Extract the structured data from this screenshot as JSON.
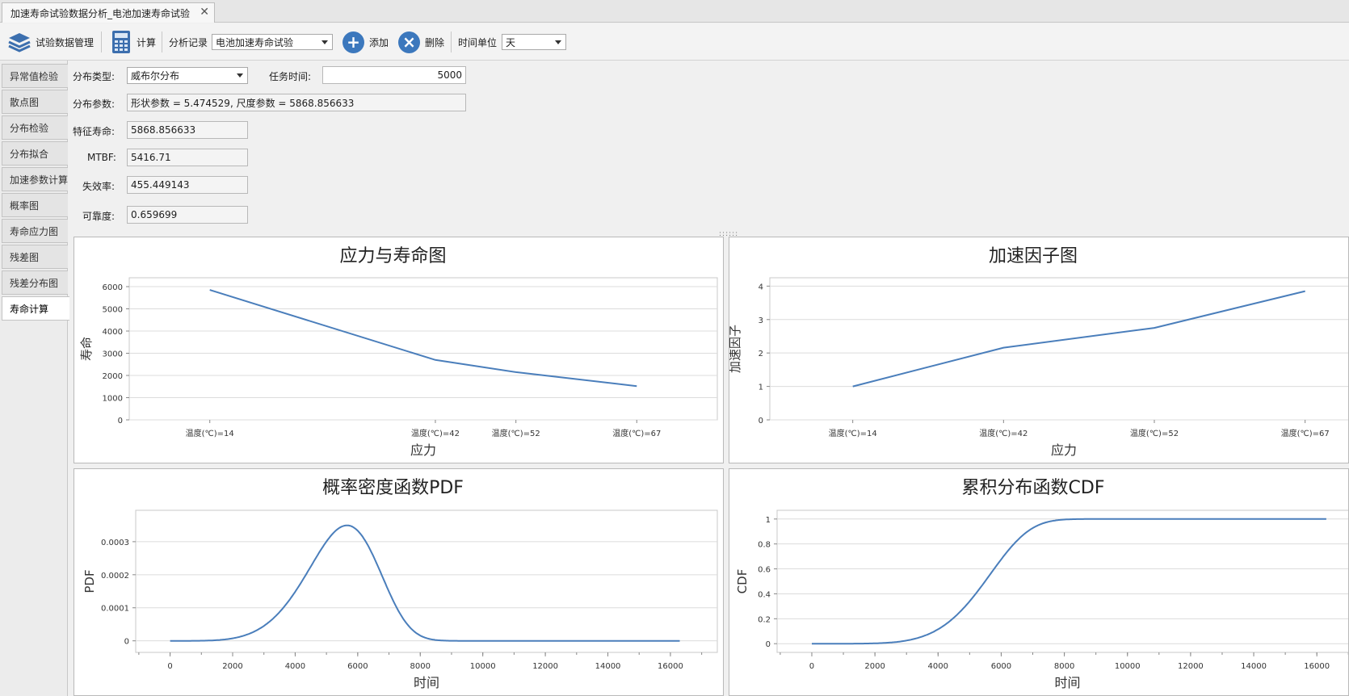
{
  "window": {
    "tab_title": "加速寿命试验数据分析_电池加速寿命试验",
    "tab_close": "✕"
  },
  "toolbar": {
    "data_manage_label": "试验数据管理",
    "calc_label": "计算",
    "record_label": "分析记录",
    "record_value": "电池加速寿命试验",
    "add_label": "添加",
    "add_glyph": "+",
    "delete_label": "删除",
    "delete_glyph": "×",
    "time_unit_label": "时间单位",
    "time_unit_value": "天"
  },
  "sidebar": {
    "items": [
      {
        "label": "异常值检验"
      },
      {
        "label": "散点图"
      },
      {
        "label": "分布检验"
      },
      {
        "label": "分布拟合"
      },
      {
        "label": "加速参数计算"
      },
      {
        "label": "概率图"
      },
      {
        "label": "寿命应力图"
      },
      {
        "label": "残差图"
      },
      {
        "label": "残差分布图"
      },
      {
        "label": "寿命计算"
      }
    ],
    "active_index": 9
  },
  "form": {
    "dist_type_label": "分布类型:",
    "dist_type_value": "威布尔分布",
    "mission_time_label": "任务时间:",
    "mission_time_value": "5000",
    "dist_params_label": "分布参数:",
    "dist_params_value": "形状参数 = 5.474529, 尺度参数 = 5868.856633",
    "char_life_label": "特征寿命:",
    "char_life_value": "5868.856633",
    "mtbf_label": "MTBF:",
    "mtbf_value": "5416.71",
    "failure_rate_label": "失效率:",
    "failure_rate_value": "455.449143",
    "reliability_label": "可靠度:",
    "reliability_value": "0.659699"
  },
  "colors": {
    "line": "#4a7ebb",
    "grid": "#dcdcdc",
    "accent": "#3c78bd"
  },
  "chart_data": [
    {
      "type": "line",
      "title": "应力与寿命图",
      "xlabel": "应力",
      "ylabel": "寿命",
      "categories": [
        "温度(℃)=14",
        "温度(℃)=42",
        "温度(℃)=52",
        "温度(℃)=67"
      ],
      "values": [
        5850,
        2700,
        2150,
        1520
      ],
      "ylim": [
        0,
        6400
      ],
      "yticks": [
        0,
        1000,
        2000,
        3000,
        4000,
        5000,
        6000
      ],
      "xpos": [
        0,
        28,
        38,
        53
      ],
      "xlim": [
        -10,
        63
      ],
      "grid": true
    },
    {
      "type": "line",
      "title": "加速因子图",
      "xlabel": "应力",
      "ylabel": "加速因子",
      "categories": [
        "温度(℃)=14",
        "温度(℃)=42",
        "温度(℃)=52",
        "温度(℃)=67"
      ],
      "values": [
        1.0,
        2.16,
        2.75,
        3.85
      ],
      "ylim": [
        0,
        4.25
      ],
      "yticks": [
        0,
        1,
        2,
        3,
        4
      ],
      "xpos": [
        0,
        1,
        2,
        3
      ],
      "xlim": [
        -0.55,
        3.35
      ],
      "grid": true
    },
    {
      "type": "line",
      "title": "概率密度函数PDF",
      "xlabel": "时间",
      "ylabel": "PDF",
      "xlim": [
        -1100,
        17500
      ],
      "ylim": [
        -3.5e-05,
        0.000395
      ],
      "xticks": [
        0,
        2000,
        4000,
        6000,
        8000,
        10000,
        12000,
        14000,
        16000
      ],
      "yticks": [
        0,
        0.0001,
        0.0002,
        0.0003
      ],
      "ytick_labels": [
        "0",
        "0.0001",
        "0.0002",
        "0.0003"
      ],
      "curve": {
        "kind": "weibull_pdf",
        "shape": 5.474529,
        "scale": 5868.856633,
        "x_from": 0,
        "x_to": 16300
      },
      "grid": true
    },
    {
      "type": "line",
      "title": "累积分布函数CDF",
      "xlabel": "时间",
      "ylabel": "CDF",
      "xlim": [
        -1100,
        17300
      ],
      "ylim": [
        -0.07,
        1.07
      ],
      "xticks": [
        0,
        2000,
        4000,
        6000,
        8000,
        10000,
        12000,
        14000,
        16000
      ],
      "yticks": [
        0,
        0.2,
        0.4,
        0.6,
        0.8,
        1
      ],
      "ytick_labels": [
        "0",
        "0.2",
        "0.4",
        "0.6",
        "0.8",
        "1"
      ],
      "curve": {
        "kind": "weibull_cdf",
        "shape": 5.474529,
        "scale": 5868.856633,
        "x_from": 0,
        "x_to": 16300
      },
      "grid": true
    }
  ]
}
